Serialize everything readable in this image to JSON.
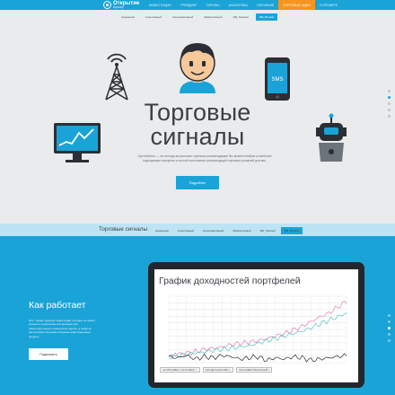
{
  "topbar": {
    "logo_main": "Открытие",
    "logo_sub": "Брокер",
    "nav": [
      "ИНВЕСТИЦИИ",
      "ТРЕЙДИНГ",
      "ТАРИФЫ",
      "АНАЛИТИКА",
      "ОБУЧЕНИЕ",
      "ТОРГОВЫЕ ИДЕИ",
      "О БРОКЕРЕ"
    ],
    "nav_active_index": 5,
    "accent": "#1aa3d7",
    "highlight": "#f7941d"
  },
  "strategies": {
    "items": [
      "Надежный",
      "Агрессивный",
      "Консервативный",
      "Эффективный",
      "ЭМ_Первый",
      "ЭМ_Второй"
    ],
    "active_index": 5
  },
  "hero": {
    "title_line1": "Торговые",
    "title_line2": "сигналы",
    "description": "OpenAdvisor — это всегда актуальные торговые рекомендации! Вы можете выбрать наиболее подходящие портфели и способ исполнения рекомендаций торговых решений для вас.",
    "button": "Подробнее",
    "phone_text": "SMS"
  },
  "signals_bar": {
    "title": "Торговые сигналы"
  },
  "how_it_works": {
    "title": "Как работает",
    "description": "Этот тариф подходит инвесторам, которые не имеют сильного стремления или времени для самостоятельного совершения сделок, а также не располагают большим объемом инвестиционных средств.",
    "button": "Подключить"
  },
  "chart_panel": {
    "title": "График доходностей портфелей",
    "legend": [
      "АКТИВ ИНВЕСТ (ПРОСПЕКТ) ×",
      "ОФЗ ДЕЛАНИЯ ЭЗБ3 ×",
      "ОФЗ ИНВЕСТИЦИОННЫЙ ×"
    ]
  },
  "chart_data": {
    "type": "line",
    "title": "График доходностей портфелей",
    "xlabel": "",
    "ylabel": "",
    "x": [
      0,
      1,
      2,
      3,
      4,
      5,
      6,
      7,
      8,
      9,
      10,
      11,
      12,
      13,
      14,
      15,
      16,
      17,
      18,
      19,
      20
    ],
    "series": [
      {
        "name": "АКТИВ ИНВЕСТ (ПРОСПЕКТ)",
        "color": "#e07bb5",
        "values": [
          0,
          2,
          3,
          4,
          6,
          7,
          8,
          10,
          11,
          12,
          13,
          15,
          17,
          19,
          22,
          25,
          29,
          33,
          36,
          41,
          46
        ]
      },
      {
        "name": "ОФЗ ДЕЛАНИЯ ЭЗБ3",
        "color": "#53c6c2",
        "values": [
          0,
          1,
          2,
          3,
          4,
          5,
          6,
          7,
          8,
          9,
          11,
          13,
          15,
          17,
          19,
          21,
          24,
          27,
          30,
          33,
          36
        ]
      },
      {
        "name": "ОФЗ ИНВЕСТИЦИОННЫЙ",
        "color": "#2b2b2b",
        "values": [
          0,
          -1,
          1,
          -2,
          0,
          -1,
          1,
          0,
          -2,
          -1,
          0,
          -3,
          -1,
          -2,
          0,
          -1,
          -3,
          -2,
          -1,
          0,
          1
        ]
      }
    ],
    "grid": true
  }
}
